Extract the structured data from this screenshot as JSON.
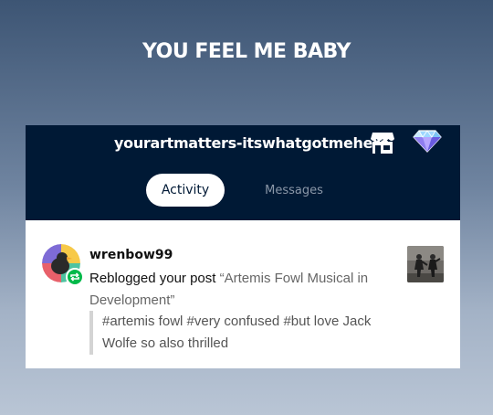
{
  "meme": {
    "caption": "YOU FEEL ME BABY"
  },
  "header": {
    "blog_name": "yourartmatters-itswhatgotmehere",
    "shop_icon": "storefront-icon",
    "premium_icon": "diamond-icon",
    "background_color": "#001935"
  },
  "tabs": [
    {
      "label": "Activity",
      "active": true
    },
    {
      "label": "Messages",
      "active": false
    }
  ],
  "notification": {
    "username": "wrenbow99",
    "badge_icon": "reblog-icon",
    "badge_color": "#00b94a",
    "action": "Reblogged your post",
    "post_title": "“Artemis Fowl Musical in Development”",
    "tags": [
      "#artemis fowl",
      "#very confused",
      "#but love Jack Wolfe so also thrilled"
    ]
  }
}
